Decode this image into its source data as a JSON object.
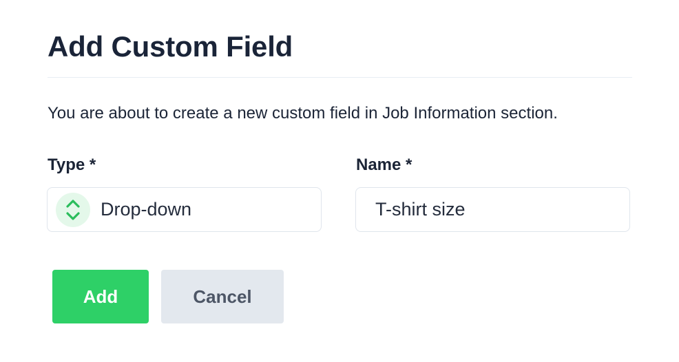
{
  "dialog": {
    "title": "Add Custom Field",
    "description": "You are about to create a new custom field in Job Information section."
  },
  "fields": {
    "type": {
      "label": "Type *",
      "value": "Drop-down",
      "icon": "chevron-up-down-icon"
    },
    "name": {
      "label": "Name *",
      "value": "T-shirt size"
    }
  },
  "buttons": {
    "add_label": "Add",
    "cancel_label": "Cancel"
  },
  "colors": {
    "accent": "#2ed067",
    "icon_bg": "#e4f8ea",
    "cancel_bg": "#e3e8ee"
  }
}
